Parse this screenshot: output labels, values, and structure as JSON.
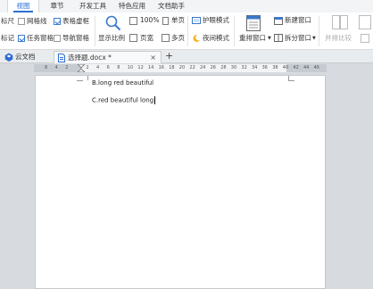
{
  "menu": {
    "tabs": [
      {
        "label": "视图",
        "active": true
      },
      {
        "label": "章节"
      },
      {
        "label": "开发工具"
      },
      {
        "label": "特色应用"
      },
      {
        "label": "文档助手"
      }
    ]
  },
  "ribbon": {
    "ruler_label": "标尺",
    "gridlines_label": "网格线",
    "table_dashed_label": "表格虚框",
    "marks_label": "标记",
    "task_pane_label": "任务窗格",
    "nav_pane_label": "导航窗格",
    "zoom_label": "显示比例",
    "zoom_100_label": "100%",
    "single_page_label": "单页",
    "page_width_label": "页宽",
    "multi_page_label": "多页",
    "eye_mode_label": "护眼模式",
    "night_mode_label": "夜间模式",
    "arrange_window_label": "重排窗口",
    "new_window_label": "新建窗口",
    "split_window_label": "拆分窗口",
    "side_by_side_label": "并排比较"
  },
  "tabs": {
    "cloud_label": "云文档",
    "doc_label": "选择题.docx *",
    "new_tab": "+"
  },
  "ruler": {
    "ticks": [
      "8",
      "4",
      "2",
      "",
      "2",
      "4",
      "6",
      "8",
      "10",
      "12",
      "14",
      "16",
      "18",
      "20",
      "22",
      "24",
      "26",
      "28",
      "30",
      "32",
      "34",
      "36",
      "38",
      "40",
      "42",
      "44",
      "46"
    ]
  },
  "document": {
    "line1": "B.long red beautiful",
    "line2": "C.red beautiful long"
  }
}
